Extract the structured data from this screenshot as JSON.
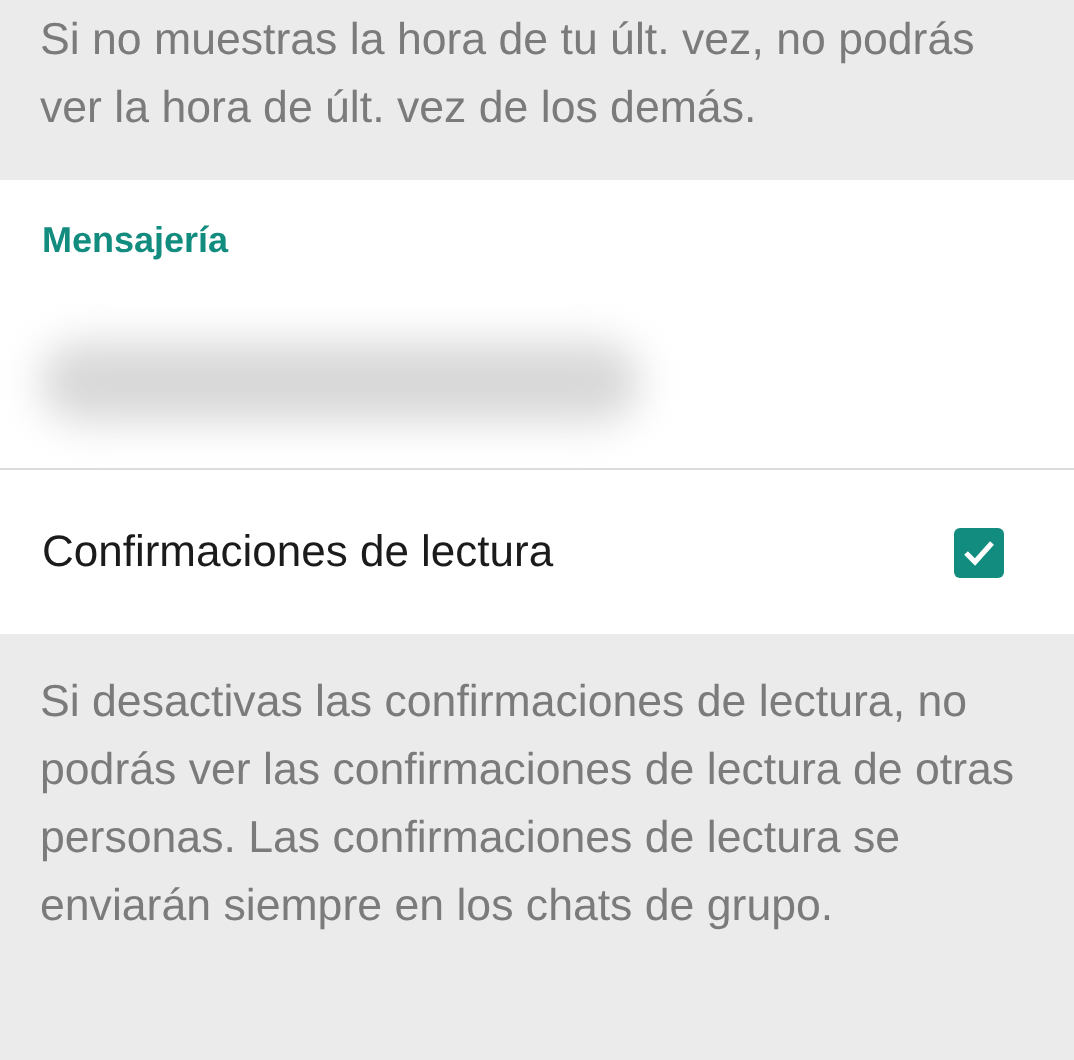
{
  "top_note": "Si no muestras la hora de tu últ. vez, no podrás ver la hora de últ. vez de los demás.",
  "section": {
    "header": "Mensajería",
    "items": [
      {
        "kind": "blurred"
      },
      {
        "kind": "checkbox",
        "label": "Confirmaciones de lectura",
        "checked": true
      }
    ]
  },
  "bottom_note": "Si desactivas las confirmaciones de lectura, no podrás ver las confirmaciones de lectura de otras personas. Las confirmaciones de lectura se enviarán siempre en los chats de grupo."
}
